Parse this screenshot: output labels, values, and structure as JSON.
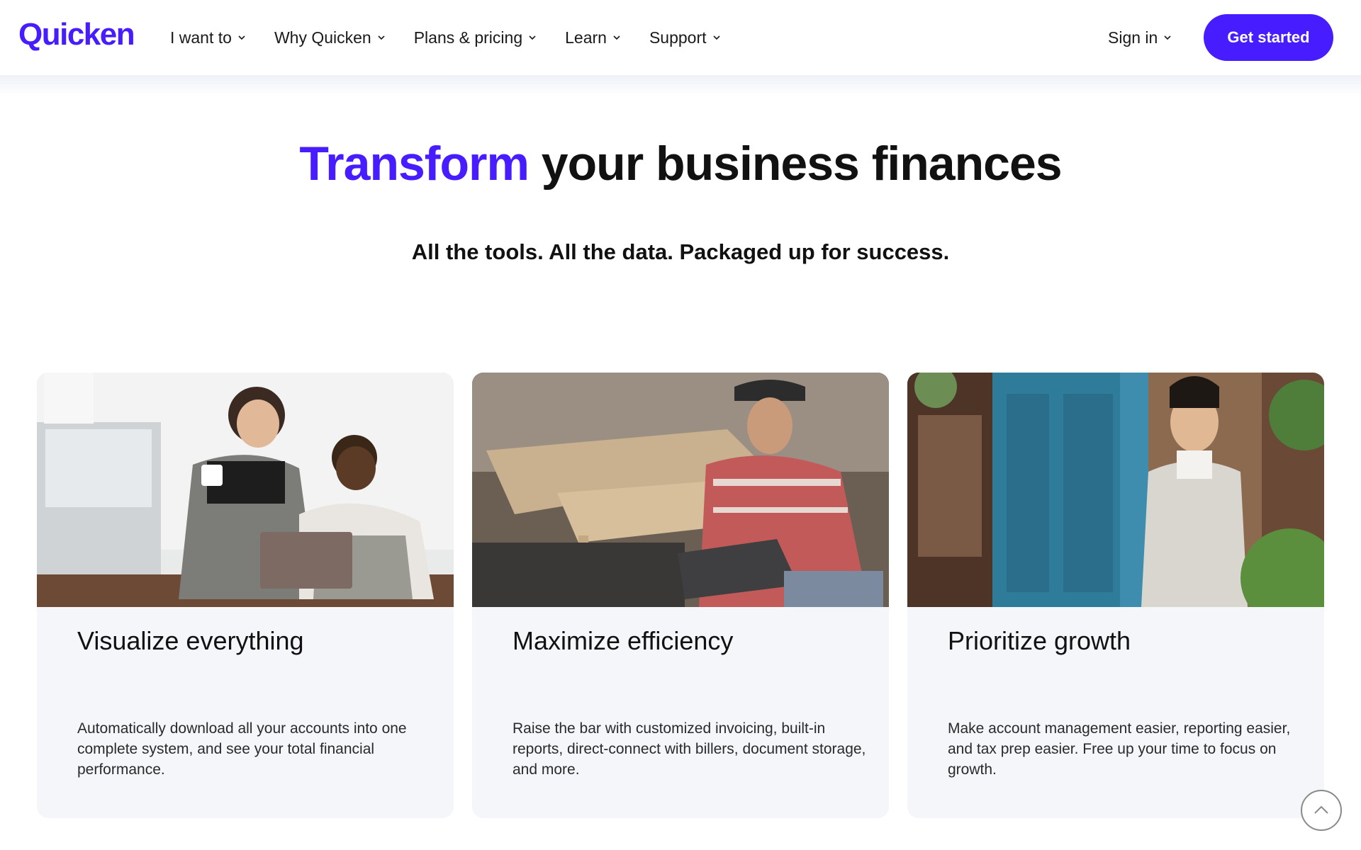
{
  "brand": {
    "logo_text": "Quicken",
    "accent_color": "#471cff"
  },
  "nav": {
    "items": [
      {
        "label": "I want to"
      },
      {
        "label": "Why Quicken"
      },
      {
        "label": "Plans & pricing"
      },
      {
        "label": "Learn"
      },
      {
        "label": "Support"
      }
    ],
    "sign_in": "Sign in",
    "cta": "Get started"
  },
  "hero": {
    "title_accent": "Transform",
    "title_rest": " your business finances",
    "subtitle": "All the tools. All the data. Packaged up for success."
  },
  "cards": [
    {
      "title": "Visualize everything",
      "text": "Automatically download all your accounts into one complete system, and see your total financial performance.",
      "image_icon": "cafe-owners-laptop-photo"
    },
    {
      "title": "Maximize efficiency",
      "text": "Raise the bar with customized invoicing, built-in reports, direct-connect with billers, document storage, and more.",
      "image_icon": "woodworker-laptop-photo"
    },
    {
      "title": "Prioritize growth",
      "text": "Make account management easier, reporting easier, and tax prep easier. Free up your time to focus on growth.",
      "image_icon": "shop-owner-door-photo"
    }
  ],
  "icons": {
    "chevron": "chevron-down-icon",
    "scroll_top": "chevron-up-icon"
  }
}
